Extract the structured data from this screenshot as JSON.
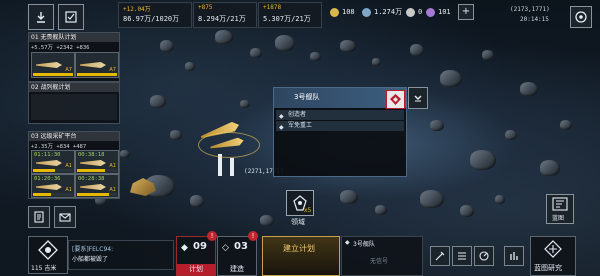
{
  "topbar": {
    "resources": [
      {
        "rate": "+12.04万",
        "amount": "86.97万/1020万",
        "color": "#8fb3c9"
      },
      {
        "rate": "+875",
        "amount": "8.294万/21万",
        "color": "#b58cd6"
      },
      {
        "rate": "+1878",
        "amount": "5.307万/21万",
        "color": "#6fbf7a"
      }
    ],
    "chip_a": "108",
    "chip_b": "1.274万",
    "chip_c": "0",
    "chip_d": "101",
    "plus": "+",
    "coords": "(2173,1771)",
    "time": "20:14:15"
  },
  "left_panel": {
    "groups": [
      {
        "title": "01 无畏舰队计划",
        "stats": "+5.57万  +2342  +836",
        "slots": [
          {
            "time": "",
            "progress": 1.0,
            "lvl": "A7"
          },
          {
            "time": "",
            "progress": 1.0,
            "lvl": "A7"
          }
        ]
      },
      {
        "title": "02 战列舰计划",
        "stats": "",
        "slots": []
      },
      {
        "title": "03 远级采矿平台",
        "stats": "+2.35万  +834  +487",
        "slots": [
          {
            "time": "01:11:30",
            "progress": 0.55,
            "lvl": "A1"
          },
          {
            "time": "00:38:18",
            "progress": 0.7,
            "lvl": "A1"
          },
          {
            "time": "01:20:36",
            "progress": 0.45,
            "lvl": "A1"
          },
          {
            "time": "00:28:38",
            "progress": 0.8,
            "lvl": "A1"
          }
        ]
      }
    ]
  },
  "fleet_popup": {
    "title": "3号舰队",
    "rows": [
      "创造者",
      "军免重工"
    ]
  },
  "map": {
    "ship_coord": "(2271,1771)",
    "guard_label": "领域",
    "guard_count": "x5"
  },
  "bottom": {
    "player_distance": "115 吉米",
    "chat_title": "[要系]FELC94:",
    "chat_msg": "小船都被毁了",
    "plan_count": "09",
    "plan_label": "计划",
    "build_count": "03",
    "build_label": "建造",
    "build_plan": "建立计划",
    "fleet_slot": "3号舰队",
    "fleet_empty": "无信号",
    "blueprint": "蓝图",
    "research": "蓝图研究",
    "badge_plan": "!",
    "badge_build": "!"
  }
}
